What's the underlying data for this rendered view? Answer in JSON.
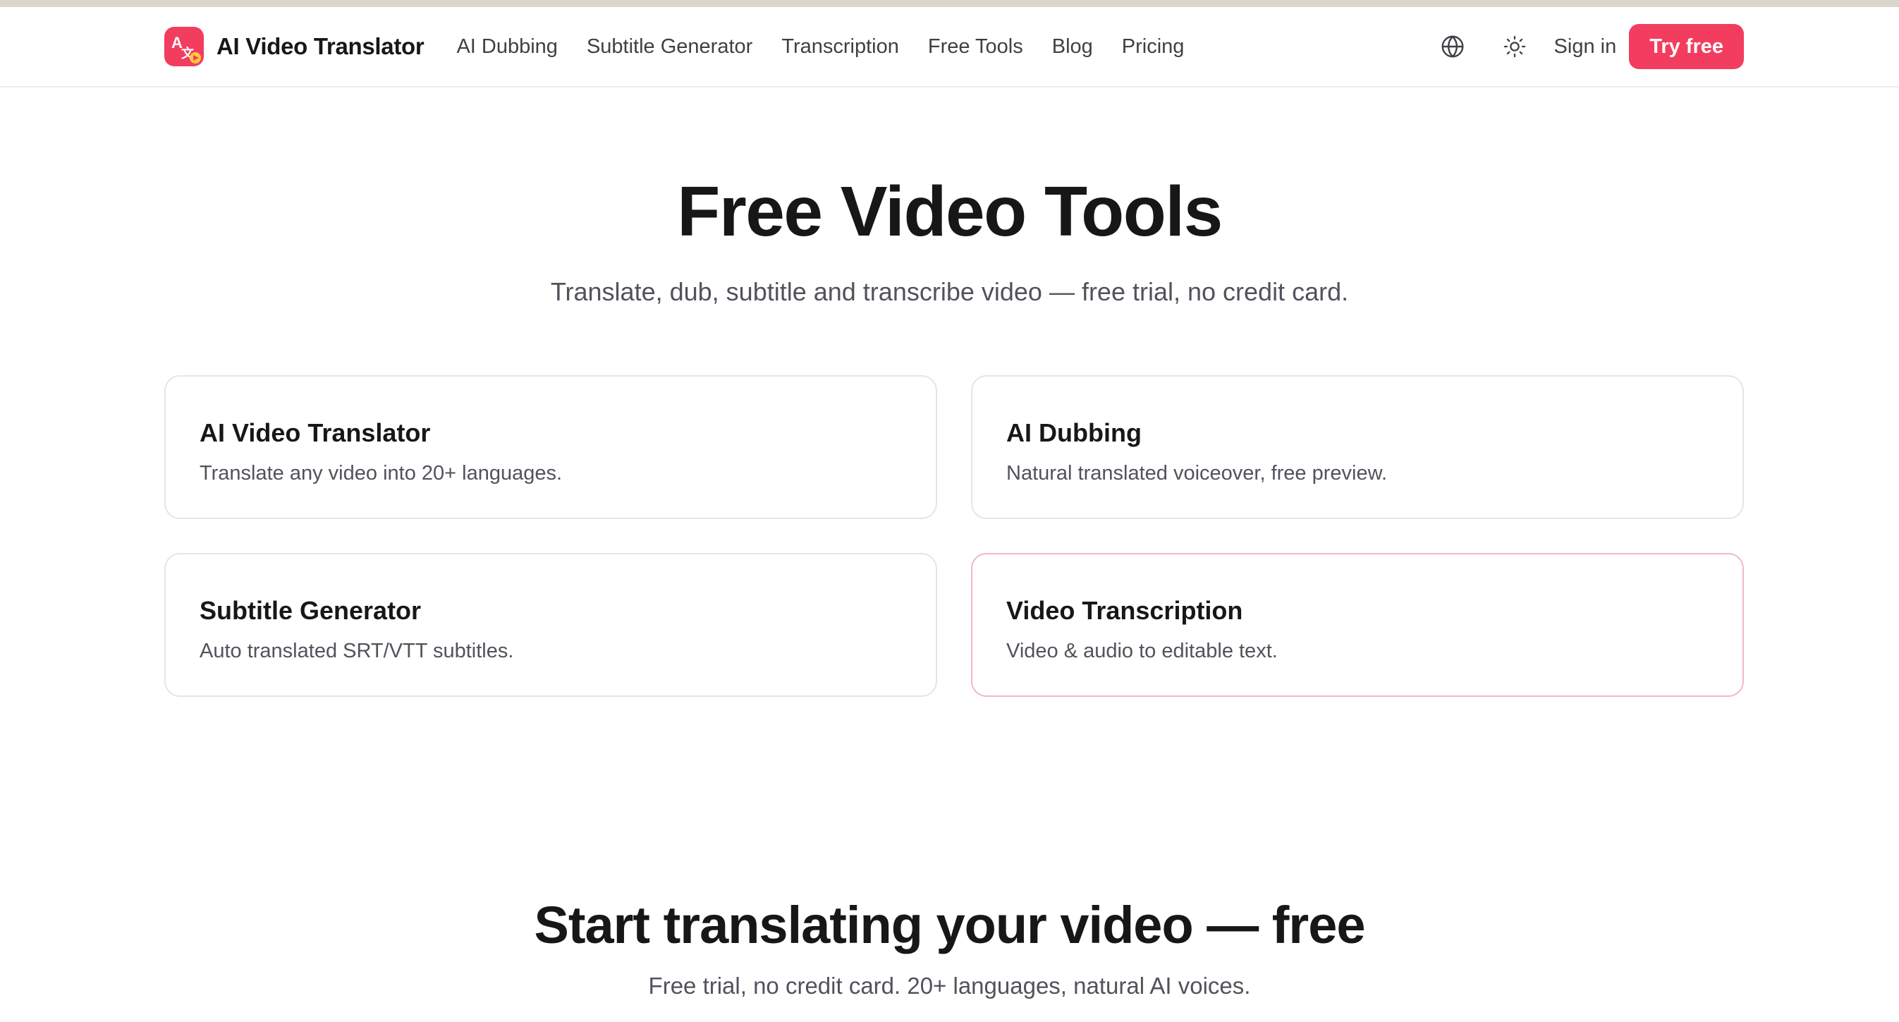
{
  "brand": {
    "name": "AI Video Translator",
    "accent_color": "#f23d5f",
    "logo_icon": "translate-logo-icon"
  },
  "nav": {
    "links": [
      "AI Dubbing",
      "Subtitle Generator",
      "Transcription",
      "Free Tools",
      "Blog",
      "Pricing"
    ],
    "language_icon": "globe-icon",
    "theme_icon": "sun-icon",
    "signin_label": "Sign in",
    "cta_label": "Try free"
  },
  "hero": {
    "title": "Free Video Tools",
    "subtitle": "Translate, dub, subtitle and transcribe video — free trial, no credit card."
  },
  "tools": [
    {
      "title": "AI Video Translator",
      "description": "Translate any video into 20+ languages."
    },
    {
      "title": "AI Dubbing",
      "description": "Natural translated voiceover, free preview."
    },
    {
      "title": "Subtitle Generator",
      "description": "Auto translated SRT/VTT subtitles."
    },
    {
      "title": "Video Transcription",
      "description": "Video & audio to editable text."
    }
  ],
  "cta": {
    "title": "Start translating your video — free",
    "subtitle": "Free trial, no credit card. 20+ languages, natural AI voices."
  }
}
